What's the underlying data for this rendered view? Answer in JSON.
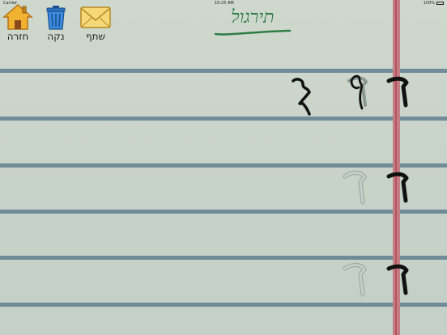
{
  "status_bar": {
    "carrier": "Carrier",
    "time": "10:25 AM",
    "battery": "100%"
  },
  "toolbar": {
    "home_label": "חזרה",
    "clear_label": "נקה",
    "share_label": "שתף"
  },
  "title": "תירגול",
  "colors": {
    "title_green": "#2f7d45",
    "margin_red": "#b4545f",
    "rule_blue": "#5f7f8e"
  },
  "icons": [
    "house-icon",
    "trash-icon",
    "envelope-icon"
  ],
  "practice_rows": [
    {
      "model_letter": "ד",
      "traced": true,
      "user_attempt": true
    },
    {
      "model_letter": "ד",
      "traced": true,
      "user_attempt": false
    },
    {
      "model_letter": "ד",
      "traced": true,
      "user_attempt": false
    }
  ]
}
